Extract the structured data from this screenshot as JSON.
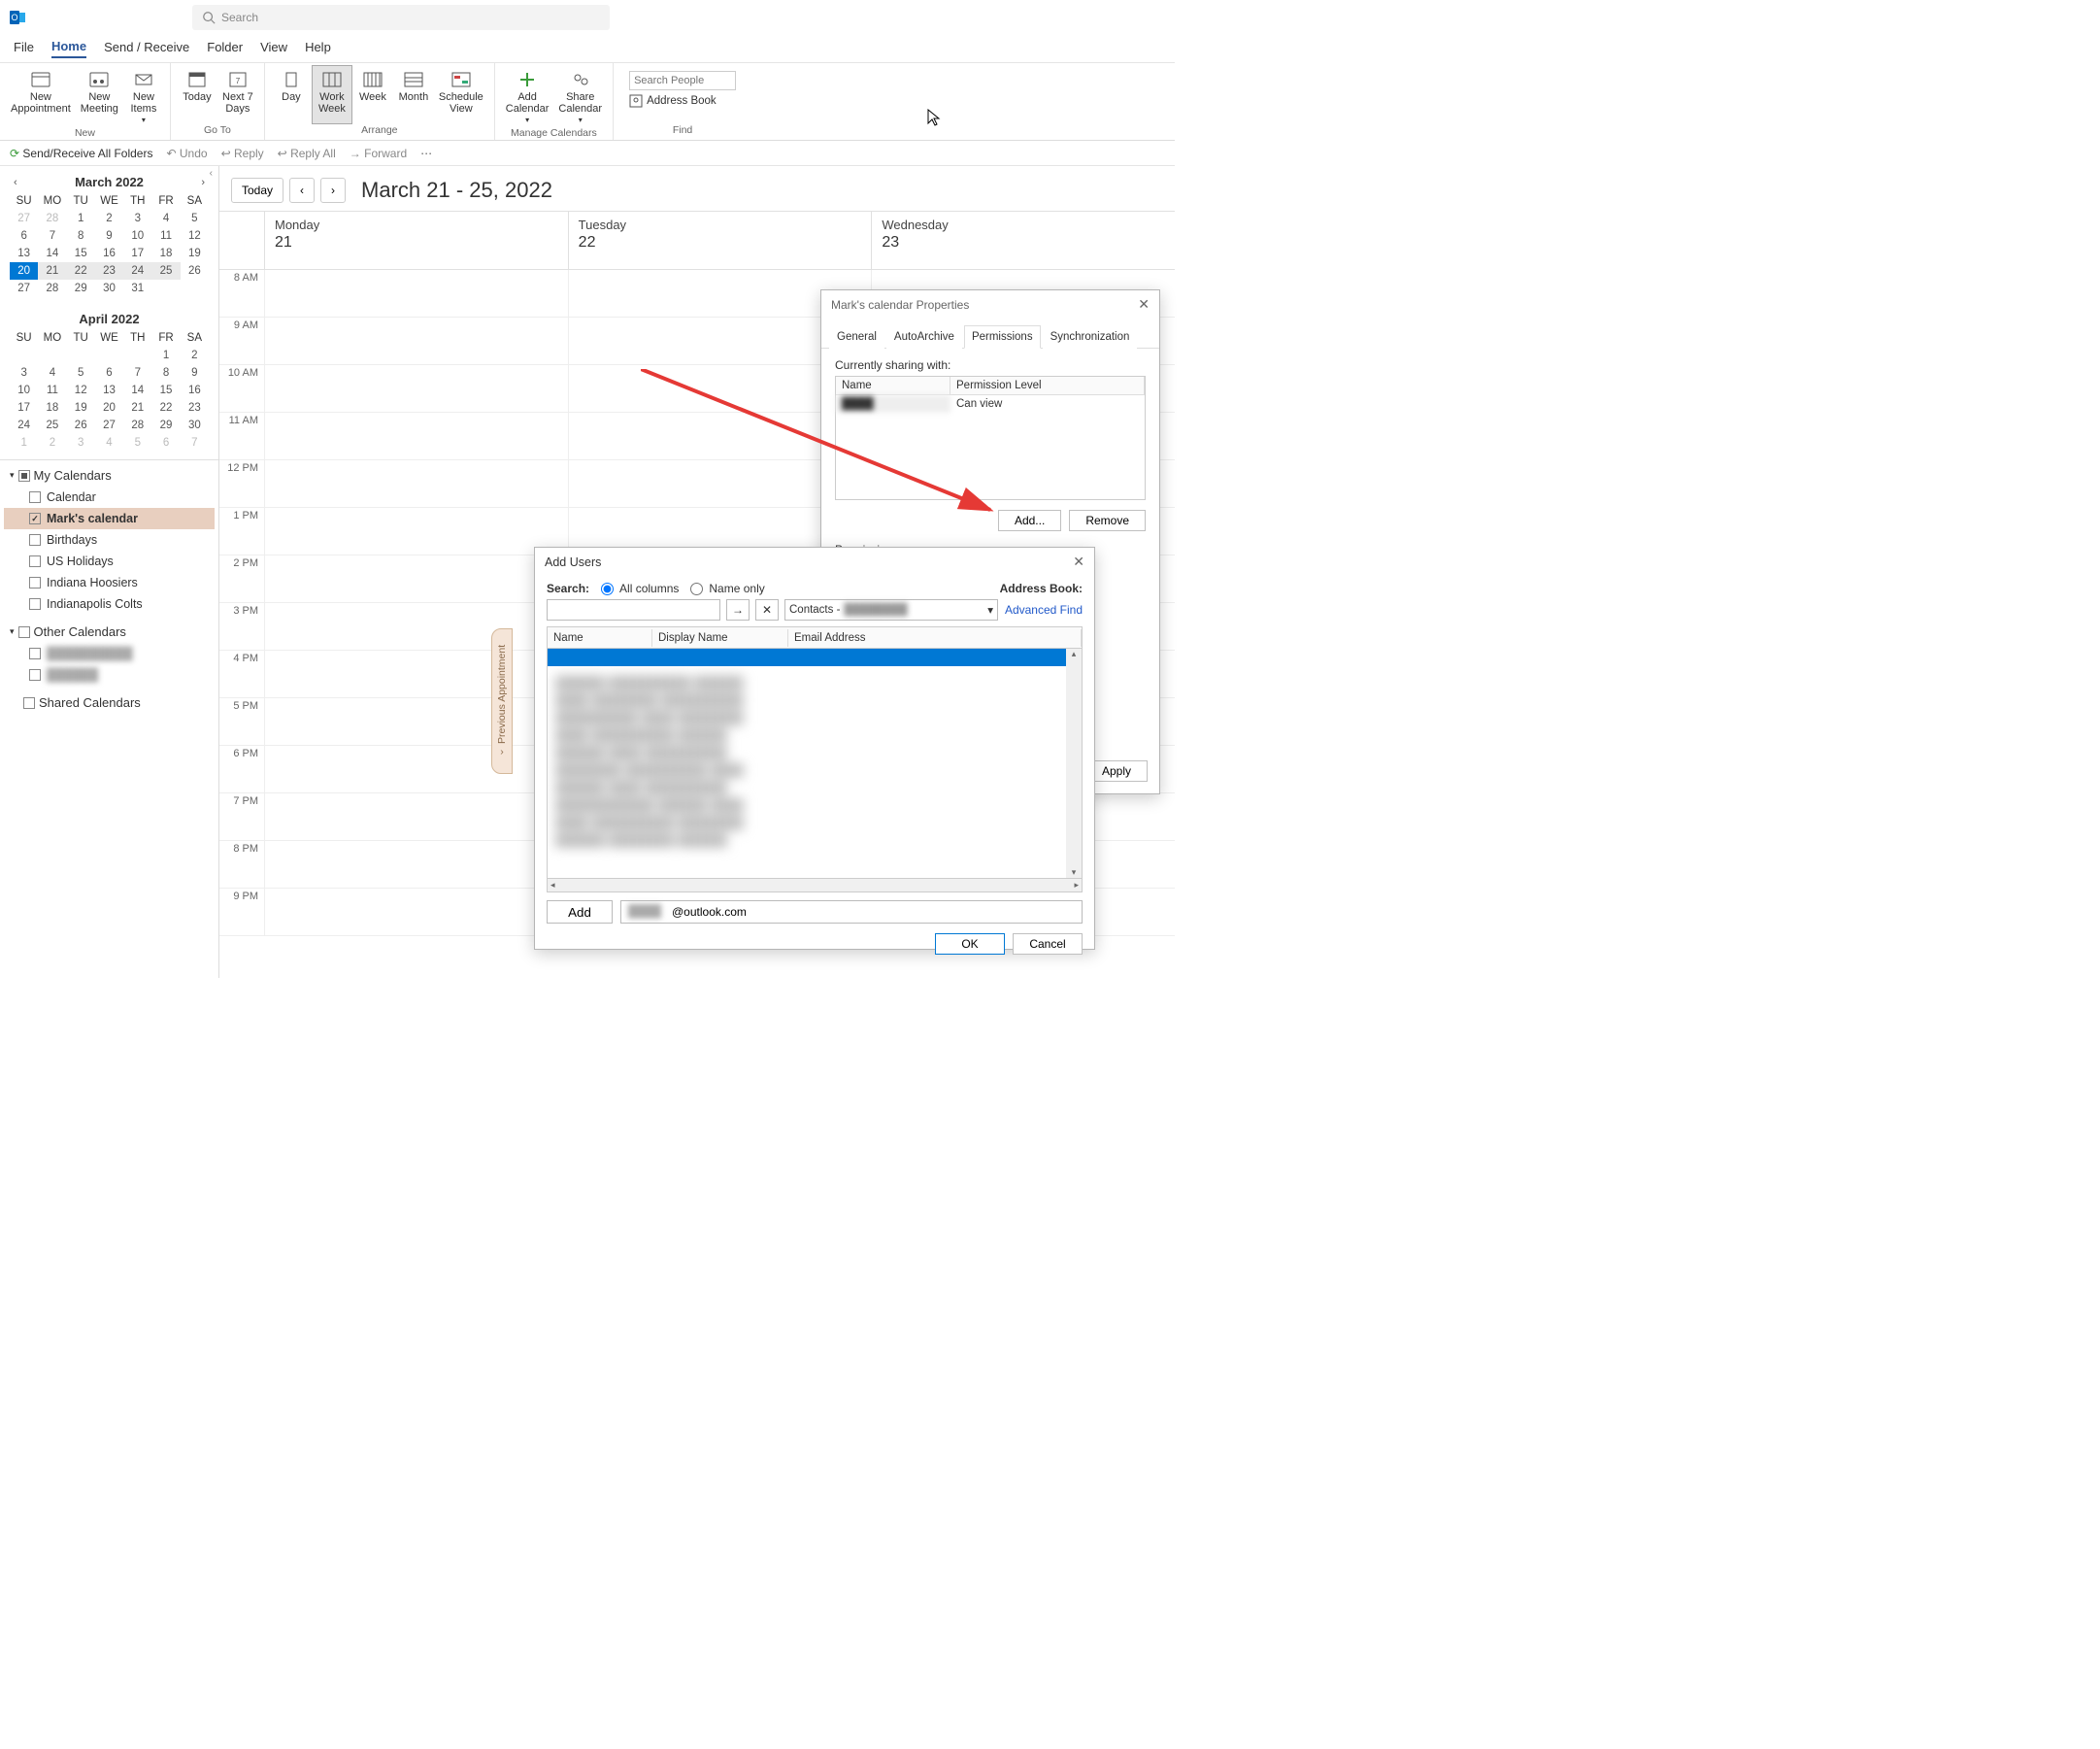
{
  "titlebar": {
    "search_placeholder": "Search"
  },
  "menubar": {
    "items": [
      "File",
      "Home",
      "Send / Receive",
      "Folder",
      "View",
      "Help"
    ],
    "active": "Home"
  },
  "ribbon": {
    "new": {
      "label": "New",
      "appointment": "New\nAppointment",
      "meeting": "New\nMeeting",
      "items": "New\nItems"
    },
    "goto": {
      "label": "Go To",
      "today": "Today",
      "next7": "Next 7\nDays"
    },
    "arrange": {
      "label": "Arrange",
      "day": "Day",
      "work_week": "Work\nWeek",
      "week": "Week",
      "month": "Month",
      "schedule": "Schedule\nView"
    },
    "manage": {
      "label": "Manage Calendars",
      "add": "Add\nCalendar",
      "share": "Share\nCalendar"
    },
    "find": {
      "label": "Find",
      "search_people": "Search People",
      "address_book": "Address Book"
    }
  },
  "quickbar": {
    "sendrecv": "Send/Receive All Folders",
    "undo": "Undo",
    "reply": "Reply",
    "reply_all": "Reply All",
    "forward": "Forward"
  },
  "sidebar": {
    "cal1": {
      "title": "March 2022",
      "dow": [
        "SU",
        "MO",
        "TU",
        "WE",
        "TH",
        "FR",
        "SA"
      ],
      "weeks": [
        [
          "27",
          "28",
          "1",
          "2",
          "3",
          "4",
          "5"
        ],
        [
          "6",
          "7",
          "8",
          "9",
          "10",
          "11",
          "12"
        ],
        [
          "13",
          "14",
          "15",
          "16",
          "17",
          "18",
          "19"
        ],
        [
          "20",
          "21",
          "22",
          "23",
          "24",
          "25",
          "26"
        ],
        [
          "27",
          "28",
          "29",
          "30",
          "31",
          "",
          ""
        ]
      ]
    },
    "cal2": {
      "title": "April 2022",
      "dow": [
        "SU",
        "MO",
        "TU",
        "WE",
        "TH",
        "FR",
        "SA"
      ],
      "weeks": [
        [
          "",
          "",
          "",
          "",
          "",
          "1",
          "2"
        ],
        [
          "3",
          "4",
          "5",
          "6",
          "7",
          "8",
          "9"
        ],
        [
          "10",
          "11",
          "12",
          "13",
          "14",
          "15",
          "16"
        ],
        [
          "17",
          "18",
          "19",
          "20",
          "21",
          "22",
          "23"
        ],
        [
          "24",
          "25",
          "26",
          "27",
          "28",
          "29",
          "30"
        ],
        [
          "1",
          "2",
          "3",
          "4",
          "5",
          "6",
          "7"
        ]
      ]
    },
    "groups": [
      {
        "title": "My Calendars",
        "items": [
          "Calendar",
          "Mark's calendar",
          "Birthdays",
          "US Holidays",
          "Indiana Hoosiers",
          "Indianapolis Colts"
        ],
        "checked": [
          1
        ]
      },
      {
        "title": "Other Calendars",
        "items": [
          "(redacted)",
          "(redacted)"
        ]
      }
    ],
    "shared": "Shared Calendars"
  },
  "calview": {
    "today": "Today",
    "title": "March 21 - 25, 2022",
    "days": [
      {
        "dow": "Monday",
        "num": "21"
      },
      {
        "dow": "Tuesday",
        "num": "22"
      },
      {
        "dow": "Wednesday",
        "num": "23"
      }
    ],
    "hours": [
      "8 AM",
      "9 AM",
      "10 AM",
      "11 AM",
      "12 PM",
      "1 PM",
      "2 PM",
      "3 PM",
      "4 PM",
      "5 PM",
      "6 PM",
      "7 PM",
      "8 PM",
      "9 PM"
    ],
    "prev_appt": "Previous Appointment"
  },
  "props_dialog": {
    "title": "Mark's calendar Properties",
    "tabs": [
      "General",
      "AutoArchive",
      "Permissions",
      "Synchronization"
    ],
    "active_tab": "Permissions",
    "sharing_label": "Currently sharing with:",
    "col_name": "Name",
    "col_perm": "Permission Level",
    "row_perm": "Can view",
    "add": "Add...",
    "remove": "Remove",
    "perm_section": "Permissions",
    "apply": "Apply"
  },
  "addusers_dialog": {
    "title": "Add Users",
    "search_label": "Search:",
    "opt_all": "All columns",
    "opt_name": "Name only",
    "addr_book_label": "Address Book:",
    "addr_book_value": "Contacts -",
    "adv_find": "Advanced Find",
    "col_name": "Name",
    "col_display": "Display Name",
    "col_email": "Email Address",
    "add_btn": "Add",
    "add_value": "@outlook.com",
    "ok": "OK",
    "cancel": "Cancel"
  }
}
